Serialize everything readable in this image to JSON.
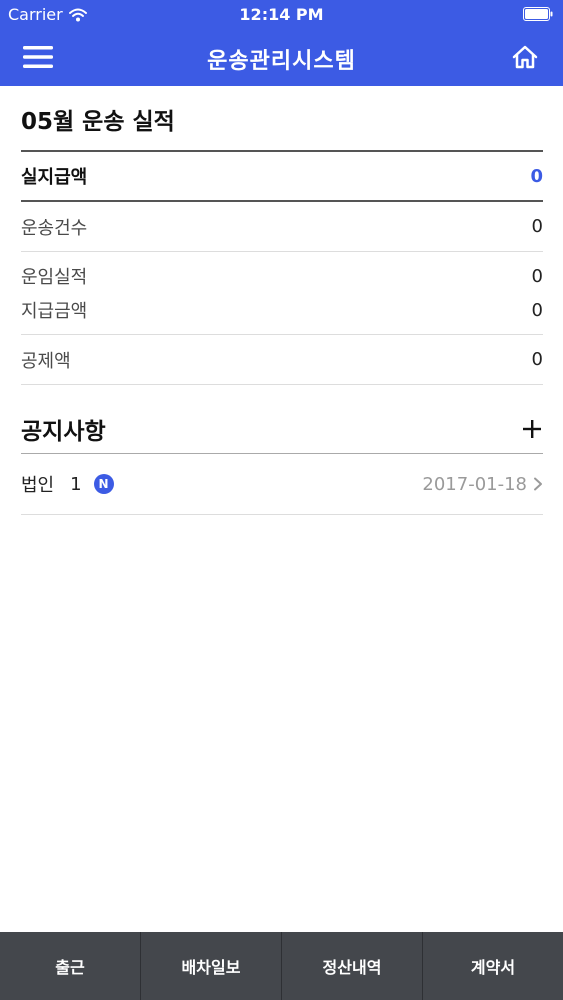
{
  "status_bar": {
    "carrier": "Carrier",
    "time": "12:14 PM",
    "icons": [
      "wifi-icon",
      "battery-icon"
    ]
  },
  "header": {
    "title": "운송관리시스템",
    "menu_icon": "hamburger-icon",
    "home_icon": "home-icon"
  },
  "summary": {
    "title": "05월 운송 실적",
    "highlight": {
      "label": "실지급액",
      "value": "0"
    },
    "rows": [
      {
        "label": "운송건수",
        "value": "0"
      },
      {
        "label": "운임실적",
        "value": "0"
      },
      {
        "label": "지급금액",
        "value": "0"
      },
      {
        "label": "공제액",
        "value": "0"
      }
    ]
  },
  "notices": {
    "title": "공지사항",
    "add_icon": "plus-icon",
    "items": [
      {
        "category": "법인",
        "count": "1",
        "badge": "N",
        "date": "2017-01-18"
      }
    ]
  },
  "tabs": [
    {
      "label": "출근"
    },
    {
      "label": "배차일보"
    },
    {
      "label": "정산내역"
    },
    {
      "label": "계약서"
    }
  ],
  "colors": {
    "accent": "#3c5be4",
    "tab_bar": "#44474c"
  }
}
